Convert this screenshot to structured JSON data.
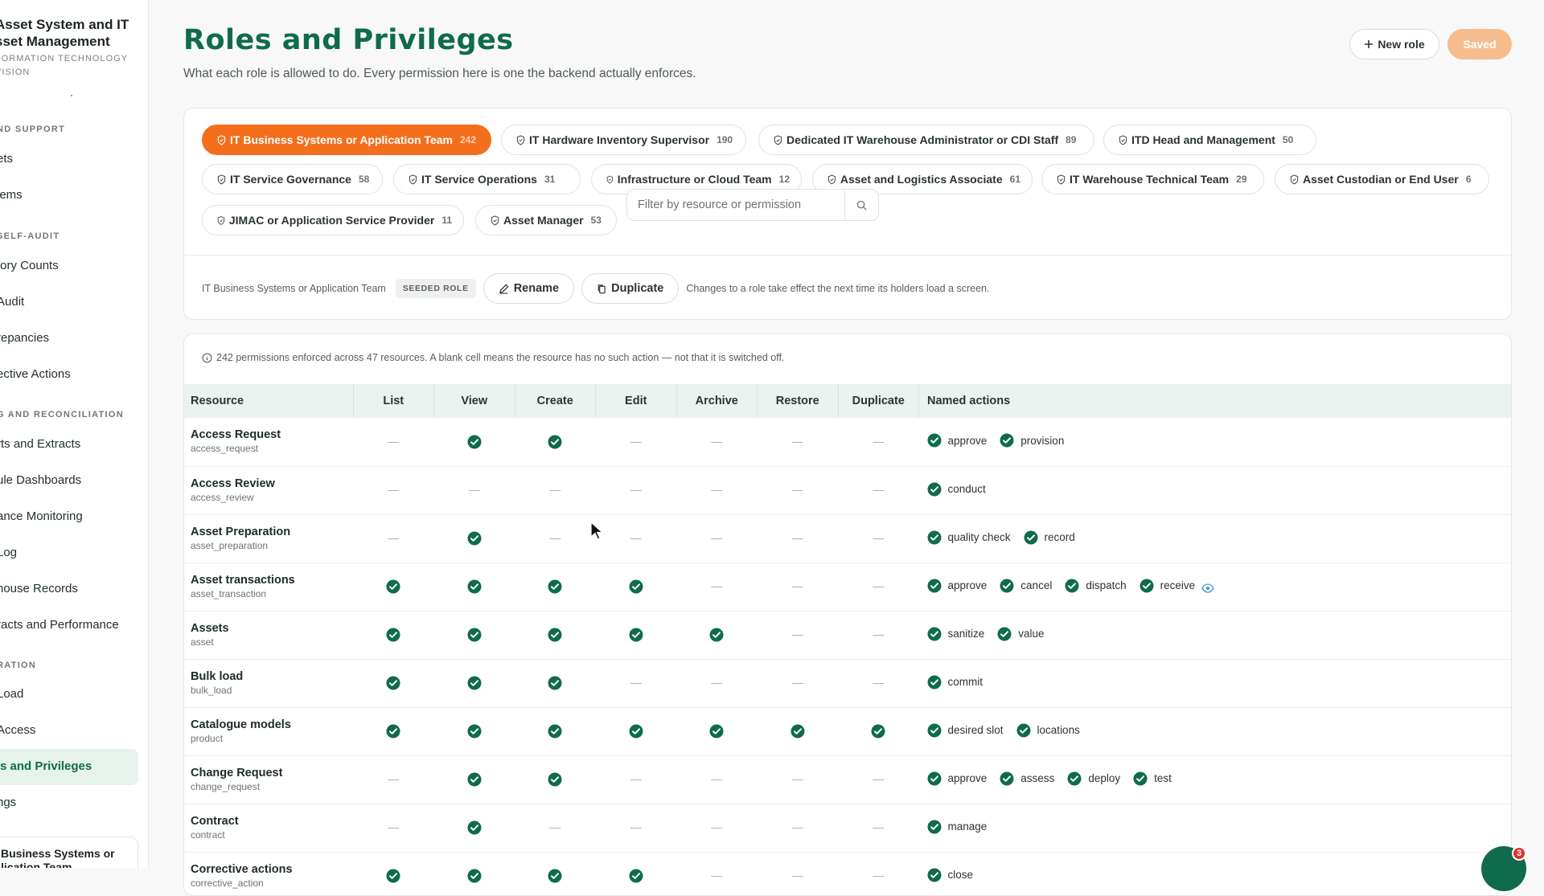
{
  "sidebar": {
    "brand_title_1": "Asset System and IT",
    "brand_title_2": "sset Management",
    "brand_sub_1": "FORMATION TECHNOLOGY",
    "brand_sub_2": "VISION",
    "sections": {
      "s1": "ND SUPPORT",
      "s2": "SELF-AUDIT",
      "s3": "G AND RECONCILIATION",
      "s4": "RATION"
    },
    "items": {
      "i1": "ets",
      "i2": "lems",
      "i3": "tory Counts",
      "i4": "Audit",
      "i5": "repancies",
      "i6": "ective Actions",
      "i7": "rts and Extracts",
      "i8": "ule Dashboards",
      "i9": "ance Monitoring",
      "i10": "Log",
      "i11": "house Records",
      "i12": "racts and Performance",
      "i13": "Load",
      "i14": "Access",
      "i15": "s and Privileges",
      "i16": "ngs"
    },
    "user_card_1": "Business Systems or",
    "user_card_2": "lication Team"
  },
  "header": {
    "title": "Roles and Privileges",
    "subtitle": "What each role is allowed to do. Every permission here is one the backend actually enforces.",
    "new_role": "New role",
    "saved": "Saved"
  },
  "roles": [
    {
      "name": "IT Business Systems or Application Team",
      "count": "242"
    },
    {
      "name": "IT Hardware Inventory Supervisor",
      "count": "190"
    },
    {
      "name": "Dedicated IT Warehouse Administrator or CDI Staff",
      "count": "89"
    },
    {
      "name": "ITD Head and Management",
      "count": "50"
    },
    {
      "name": "IT Service Governance",
      "count": "58"
    },
    {
      "name": "IT Service Operations",
      "count": "31"
    },
    {
      "name": "Infrastructure or Cloud Team",
      "count": "12"
    },
    {
      "name": "Asset and Logistics Associate",
      "count": "61"
    },
    {
      "name": "IT Warehouse Technical Team",
      "count": "29"
    },
    {
      "name": "Asset Custodian or End User",
      "count": "6"
    },
    {
      "name": "JIMAC or Application Service Provider",
      "count": "11"
    },
    {
      "name": "Asset Manager",
      "count": "53"
    }
  ],
  "filter": {
    "placeholder": "Filter by resource or permission"
  },
  "role_bar": {
    "selected": "IT Business Systems or Application Team",
    "badge": "SEEDED ROLE",
    "rename": "Rename",
    "duplicate": "Duplicate",
    "note": "Changes to a role take effect the next time its holders load a screen."
  },
  "matrix": {
    "info": "242 permissions enforced across 47 resources. A blank cell means the resource has no such action — not that it is switched off.",
    "columns": [
      "Resource",
      "List",
      "View",
      "Create",
      "Edit",
      "Archive",
      "Restore",
      "Duplicate",
      "Named actions"
    ],
    "dash": "—",
    "rows": [
      {
        "name": "Access Request",
        "key": "access_request",
        "cells": [
          0,
          1,
          1,
          0,
          0,
          0,
          0
        ],
        "actions": [
          "approve",
          "provision"
        ]
      },
      {
        "name": "Access Review",
        "key": "access_review",
        "cells": [
          0,
          0,
          0,
          0,
          0,
          0,
          0
        ],
        "actions": [
          "conduct"
        ]
      },
      {
        "name": "Asset Preparation",
        "key": "asset_preparation",
        "cells": [
          0,
          1,
          0,
          0,
          0,
          0,
          0
        ],
        "actions": [
          "quality check",
          "record"
        ]
      },
      {
        "name": "Asset transactions",
        "key": "asset_transaction",
        "cells": [
          1,
          1,
          1,
          1,
          0,
          0,
          0
        ],
        "actions": [
          "approve",
          "cancel",
          "dispatch",
          "receive"
        ],
        "eye": true
      },
      {
        "name": "Assets",
        "key": "asset",
        "cells": [
          1,
          1,
          1,
          1,
          1,
          0,
          0
        ],
        "actions": [
          "sanitize",
          "value"
        ]
      },
      {
        "name": "Bulk load",
        "key": "bulk_load",
        "cells": [
          1,
          1,
          1,
          0,
          0,
          0,
          0
        ],
        "actions": [
          "commit"
        ]
      },
      {
        "name": "Catalogue models",
        "key": "product",
        "cells": [
          1,
          1,
          1,
          1,
          1,
          1,
          1
        ],
        "actions": [
          "desired slot",
          "locations"
        ]
      },
      {
        "name": "Change Request",
        "key": "change_request",
        "cells": [
          0,
          1,
          1,
          0,
          0,
          0,
          0
        ],
        "actions": [
          "approve",
          "assess",
          "deploy",
          "test"
        ]
      },
      {
        "name": "Contract",
        "key": "contract",
        "cells": [
          0,
          1,
          0,
          0,
          0,
          0,
          0
        ],
        "actions": [
          "manage"
        ]
      },
      {
        "name": "Corrective actions",
        "key": "corrective_action",
        "cells": [
          1,
          1,
          1,
          1,
          0,
          0,
          0
        ],
        "actions": [
          "close"
        ]
      }
    ]
  },
  "notifications": {
    "count": "3"
  },
  "colors": {
    "accent": "#0f6b4b",
    "chip_active": "#f36f1c",
    "saved": "#f7bc8e"
  }
}
